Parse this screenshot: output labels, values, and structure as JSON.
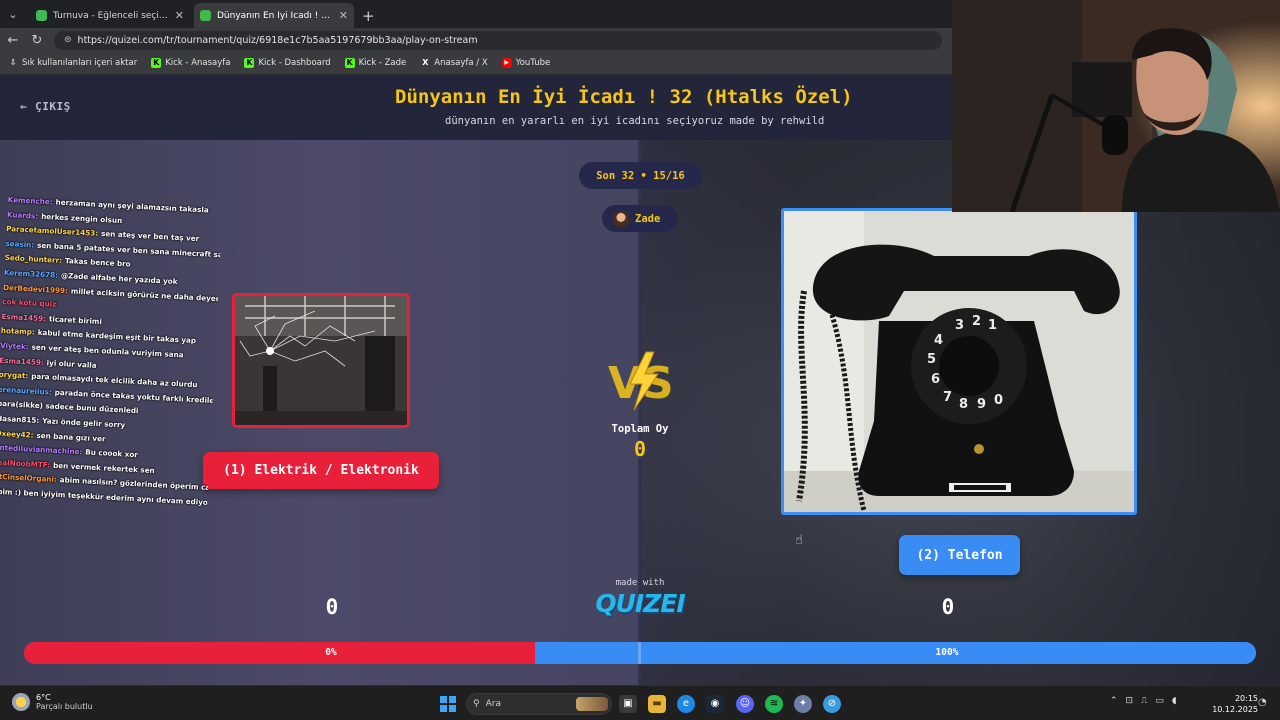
{
  "browser": {
    "tabs": [
      {
        "title": "Turnuva - Eğlenceli seçimler yapı",
        "active": false
      },
      {
        "title": "Dünyanın En İyi İcadı ! 32 (Htalks Ö",
        "active": true
      }
    ],
    "url": "https://quizei.com/tr/tournament/quiz/6918e1c7b5aa5197679bb3aa/play-on-stream",
    "bookmarks": [
      {
        "label": "Sık kullanılanları içeri aktar",
        "icon": "import-icon"
      },
      {
        "label": "Kick - Anasayfa",
        "icon": "kick-icon"
      },
      {
        "label": "Kick - Dashboard",
        "icon": "kick-icon"
      },
      {
        "label": "Kick - Zade",
        "icon": "kick-icon"
      },
      {
        "label": "Anasayfa / X",
        "icon": "x-icon"
      },
      {
        "label": "YouTube",
        "icon": "youtube-icon"
      }
    ]
  },
  "header": {
    "back_label": "ÇIKIŞ",
    "title": "Dünyanın En İyi İcadı ! 32 (Htalks Özel)",
    "subtitle": "dünyanın en yararlı en iyi icadını seçiyoruz made by rehwild"
  },
  "match": {
    "round": "Son 32 • 15/16",
    "user": "Zade",
    "total_label": "Toplam Oy",
    "total_votes": "0",
    "left": {
      "label": "(1) Elektrik / Elektronik",
      "score": "0",
      "percent_label": "0%",
      "percent": 0,
      "color": "#e8203a"
    },
    "right": {
      "label": "(2) Telefon",
      "score": "0",
      "percent_label": "100%",
      "percent": 100,
      "color": "#3a8cf5"
    },
    "made_with": "made with",
    "brand": "QUIZEI"
  },
  "chat": [
    {
      "user": "Kemenche:",
      "msg": "herzaman aynı şeyi alamazsın takasla",
      "color": "#b87cff"
    },
    {
      "user": "Kuards:",
      "msg": "herkes zengin olsun",
      "color": "#b87cff"
    },
    {
      "user": "ParacetamolUser1453:",
      "msg": "sen ateş ver ben taş ver",
      "color": "#ffd84a"
    },
    {
      "user": "seasin:",
      "msg": "sen bana 5 patates ver ben sana minecraft satayım",
      "color": "#5aa9ff"
    },
    {
      "user": "Sedo_hunterr:",
      "msg": "Takas bence bro",
      "color": "#ffd84a"
    },
    {
      "user": "Kerem32678:",
      "msg": "@Zade alfabe her yazıda yok",
      "color": "#5aa9ff"
    },
    {
      "user": "DerBedevi1999:",
      "msg": "millet aciksin görürüz ne daha deyerli",
      "color": "#ff9a3c"
    },
    {
      "user": "",
      "msg": "çok kötü quiz",
      "color": "#ff4d6d"
    },
    {
      "user": "Esma1459:",
      "msg": "ticaret birimi",
      "color": "#ff6f9f"
    },
    {
      "user": "hotamp:",
      "msg": "kabul etme kardeşim eşit bir takas yap",
      "color": "#ffd84a"
    },
    {
      "user": "Viytek:",
      "msg": "sen ver ateş ben odunla vuriyim sana",
      "color": "#b87cff"
    },
    {
      "user": "Esma1459:",
      "msg": "iyi olur valla",
      "color": "#ff6f9f"
    },
    {
      "user": "prygat:",
      "msg": "para olmasaydı tek elcilik daha az olurdu",
      "color": "#ffd84a"
    },
    {
      "user": "erenaureiius:",
      "msg": "paradan önce takas yoktu farklı krediler vardı",
      "color": "#5aa9ff"
    },
    {
      "user": "",
      "msg": "para(sikke) sadece bunu düzenledi",
      "color": "#ffffff"
    },
    {
      "user": "Hasan815:",
      "msg": "Yazı önde gelir sorry",
      "color": "#ffffff"
    },
    {
      "user": "Oxeey42:",
      "msg": "sen bana gızı ver",
      "color": "#ffd84a"
    },
    {
      "user": "antediluvianmachine:",
      "msg": "Bu coook xor",
      "color": "#b87cff"
    },
    {
      "user": "realNoobMTF:",
      "msg": "ben vermek rekertek sen",
      "color": "#ff4d6d"
    },
    {
      "user": "AtCinselOrgani:",
      "msg": "abim nasılsın? gözlerinden öperim canım",
      "color": "#ff9a3c"
    },
    {
      "user": "",
      "msg": "abim :) ben iyiyim teşekkür ederim aynı devam ediyor...",
      "color": "#ffffff"
    }
  ],
  "taskbar": {
    "temp": "6°C",
    "weather": "Parçalı bulutlu",
    "search_placeholder": "Ara",
    "time": "20:15",
    "date": "10.12.2025"
  }
}
